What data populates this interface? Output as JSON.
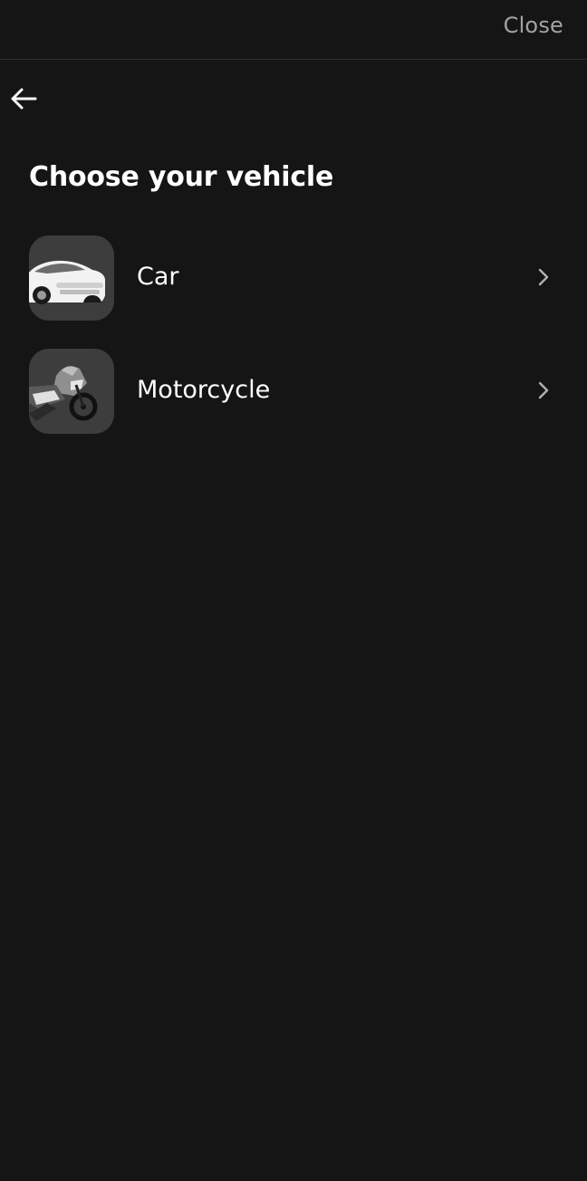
{
  "header": {
    "close_label": "Close"
  },
  "page": {
    "title": "Choose your vehicle"
  },
  "vehicles": [
    {
      "label": "Car",
      "icon": "car-image"
    },
    {
      "label": "Motorcycle",
      "icon": "motorcycle-image"
    }
  ],
  "colors": {
    "background": "#151515",
    "text": "#ffffff",
    "muted": "#a3a3a3",
    "thumb_bg": "#3d3d3d"
  }
}
